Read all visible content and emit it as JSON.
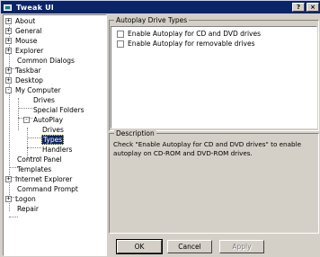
{
  "window": {
    "title": "Tweak UI"
  },
  "title_buttons": {
    "help": "?",
    "close": "×"
  },
  "tree": [
    {
      "label": "About",
      "expander": "+"
    },
    {
      "label": "General",
      "expander": "+"
    },
    {
      "label": "Mouse",
      "expander": "+"
    },
    {
      "label": "Explorer",
      "expander": "+"
    },
    {
      "label": "Common Dialogs",
      "expander": ""
    },
    {
      "label": "Taskbar",
      "expander": "+"
    },
    {
      "label": "Desktop",
      "expander": "+"
    },
    {
      "label": "My Computer",
      "expander": "-"
    },
    {
      "label": "Drives",
      "expander": ""
    },
    {
      "label": "Special Folders",
      "expander": ""
    },
    {
      "label": "AutoPlay",
      "expander": "-"
    },
    {
      "label": "Drives",
      "expander": ""
    },
    {
      "label": "Types",
      "expander": "",
      "selected": true
    },
    {
      "label": "Handlers",
      "expander": ""
    },
    {
      "label": "Control Panel",
      "expander": ""
    },
    {
      "label": "Templates",
      "expander": ""
    },
    {
      "label": "Internet Explorer",
      "expander": "+"
    },
    {
      "label": "Command Prompt",
      "expander": ""
    },
    {
      "label": "Logon",
      "expander": "+"
    },
    {
      "label": "Repair",
      "expander": ""
    }
  ],
  "autoplay": {
    "group_title": "Autoplay Drive Types",
    "options": [
      {
        "label": "Enable Autoplay for CD and DVD drives",
        "checked": false
      },
      {
        "label": "Enable Autoplay for removable drives",
        "checked": false
      }
    ]
  },
  "description": {
    "title": "Description",
    "text": "Check \"Enable Autoplay for CD and DVD drives\" to enable autoplay on CD-ROM and DVD-ROM drives."
  },
  "buttons": {
    "ok": "OK",
    "cancel": "Cancel",
    "apply": "Apply"
  }
}
